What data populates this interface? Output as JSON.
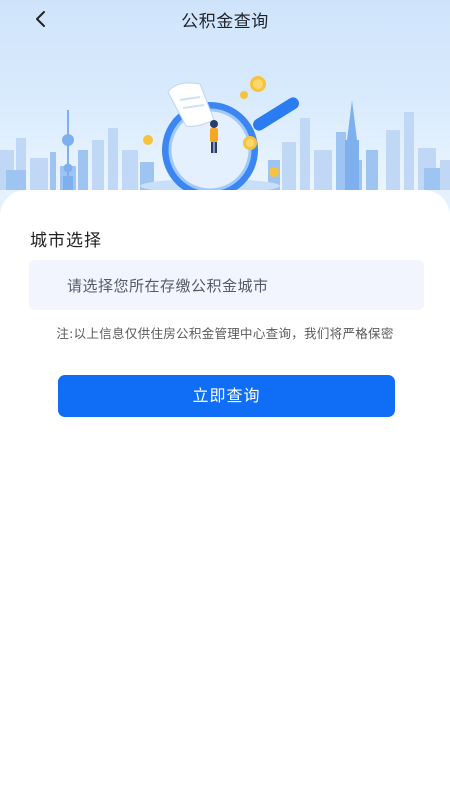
{
  "nav": {
    "back_icon": "chevron-left-icon",
    "title": "公积金查询"
  },
  "hero": {
    "illustration": "magnifier-city-illustration"
  },
  "form": {
    "section_label": "城市选择",
    "city_placeholder": "请选择您所在存缴公积金城市",
    "notice": "注:以上信息仅供住房公积金管理中心查询，我们将严格保密",
    "submit_label": "立即查询"
  },
  "colors": {
    "primary": "#0f6ef5",
    "field_bg": "#f2f5fd",
    "hero_bg": "#d9ebfd"
  }
}
